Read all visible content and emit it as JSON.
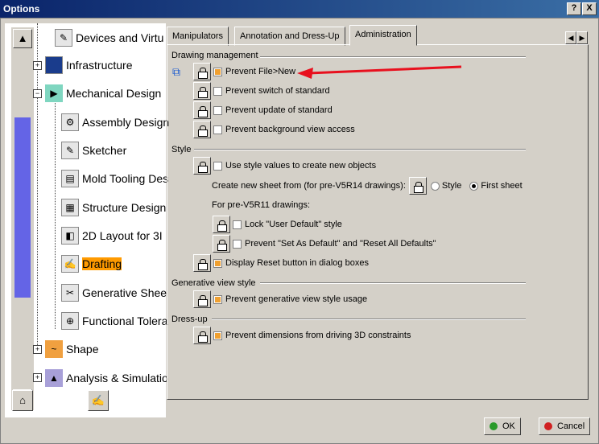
{
  "window": {
    "title": "Options",
    "help_button": "?",
    "close_button": "X"
  },
  "tree": {
    "items": [
      {
        "label": "Devices and Virtu",
        "icon": "devices-icon"
      },
      {
        "label": "Infrastructure",
        "icon": "infrastructure-icon"
      },
      {
        "label": "Mechanical Design",
        "icon": "mechanical-design-icon"
      },
      {
        "label": "Assembly Design",
        "icon": "assembly-design-icon"
      },
      {
        "label": "Sketcher",
        "icon": "sketcher-icon"
      },
      {
        "label": "Mold Tooling Des",
        "icon": "mold-tooling-icon"
      },
      {
        "label": "Structure Design",
        "icon": "structure-design-icon"
      },
      {
        "label": "2D Layout for 3I",
        "icon": "2d-layout-icon"
      },
      {
        "label": "Drafting",
        "icon": "drafting-icon",
        "selected": true
      },
      {
        "label": "Generative Shee",
        "icon": "generative-sheetmetal-icon"
      },
      {
        "label": "Functional Tolera",
        "icon": "functional-tolerancing-icon"
      },
      {
        "label": "Shape",
        "icon": "shape-icon"
      },
      {
        "label": "Analysis & Simulatio",
        "icon": "analysis-simulation-icon"
      }
    ]
  },
  "tabs": {
    "manipulators": "Manipulators",
    "annotation": "Annotation and Dress-Up",
    "administration": "Administration",
    "active": "Administration"
  },
  "sections": {
    "drawing_management": {
      "title": "Drawing management",
      "options": [
        {
          "label": "Prevent File>New",
          "checked": true
        },
        {
          "label": "Prevent switch of standard",
          "checked": false
        },
        {
          "label": "Prevent update of standard",
          "checked": false
        },
        {
          "label": "Prevent background view access",
          "checked": false
        }
      ]
    },
    "style": {
      "title": "Style",
      "use_style": {
        "label": "Use style values to create new objects",
        "checked": false
      },
      "create_new_sheet": "Create new sheet from (for pre-V5R14 drawings):",
      "radio_style": "Style",
      "radio_first_sheet": "First sheet",
      "radio_selected": "First sheet",
      "pre_v5r11": "For pre-V5R11 drawings:",
      "lock_user_default": {
        "label": "Lock \"User Default\" style",
        "checked": false
      },
      "prevent_set_as_default": {
        "label": "Prevent \"Set As Default\" and \"Reset All Defaults\"",
        "checked": false
      },
      "display_reset": {
        "label": "Display Reset button in dialog boxes",
        "checked": true
      }
    },
    "generative_view_style": {
      "title": "Generative view style",
      "option": {
        "label": "Prevent generative view style usage",
        "checked": true
      }
    },
    "dress_up": {
      "title": "Dress-up",
      "option": {
        "label": "Prevent dimensions from driving 3D constraints",
        "checked": true
      }
    }
  },
  "buttons": {
    "ok": "OK",
    "cancel": "Cancel"
  },
  "colors": {
    "selection": "#ff9a00",
    "arrow": "#e8101e",
    "scroll_thumb": "#6464e6"
  }
}
